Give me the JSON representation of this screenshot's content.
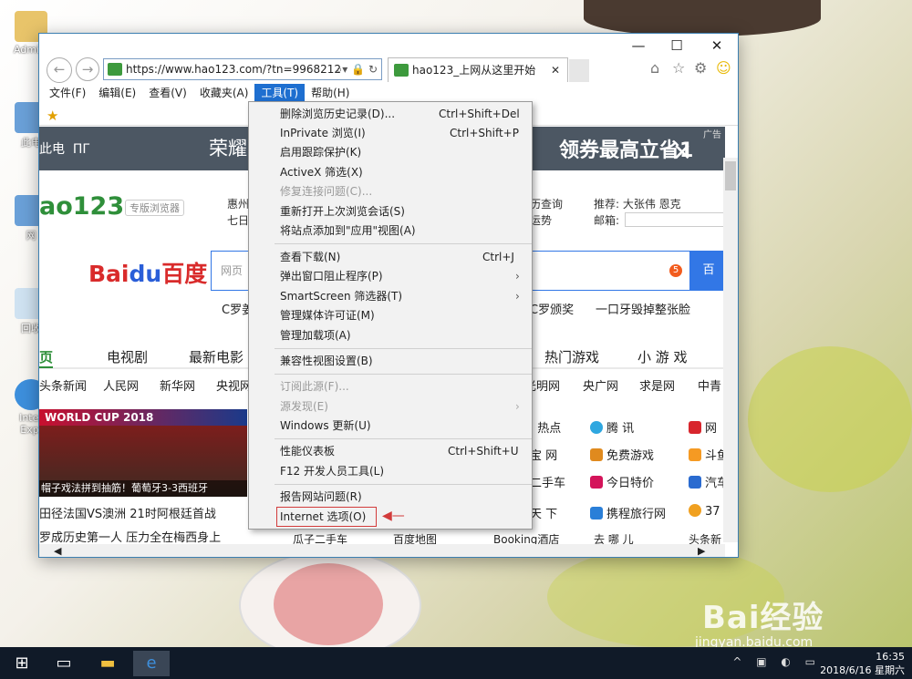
{
  "desktop": {
    "icons": [
      {
        "label": "Admini",
        "color": "#e8c46a"
      },
      {
        "label": "此电",
        "color": "#6aa0d8"
      },
      {
        "label": "网",
        "color": "#6aa0d8"
      },
      {
        "label": "回收",
        "color": "#cfe2f1"
      },
      {
        "label": "Inter\nExpl",
        "color": "#3d8fdc"
      }
    ],
    "watermark": "Bai经验",
    "watermark_url": "jingyan.baidu.com"
  },
  "browser": {
    "address": "https://www.hao123.com/?tn=9968212",
    "tab_title": "hao123_上网从这里开始",
    "menu": [
      "文件(F)",
      "编辑(E)",
      "查看(V)",
      "收藏夹(A)",
      "工具(T)",
      "帮助(H)"
    ],
    "active_menu": "工具(T)"
  },
  "page": {
    "banner_left": "荣耀",
    "banner_left_prefix": "此电  ΠΓ",
    "banner_right": "领券最高立省1",
    "ad_label": "广告",
    "hao_logo": "ao123",
    "hao_tag": "专版浏览器",
    "weather_lines": [
      "惠州",
      "七日"
    ],
    "right_info": [
      "历查询",
      "运势"
    ],
    "recommend": "推荐: 大张伟 恩克",
    "mailbox": "邮箱:",
    "baidu_logo": "Bai",
    "baidu_du": "du",
    "baidu_cn": "百度",
    "search_placeholder": "网页",
    "search_badge": "5",
    "search_button": "百",
    "hot": [
      "C罗姜",
      "C罗颁奖",
      "一口牙毁掉整张脸"
    ],
    "nav_tabs": [
      "页",
      "电视剧",
      "最新电影",
      "热门游戏",
      "小 游 戏"
    ],
    "links": [
      "头条新闻",
      "人民网",
      "新华网",
      "央视网",
      "光明网",
      "央广网",
      "求是网",
      "中青"
    ],
    "worldcup_title": "WORLD CUP 2018",
    "worldcup_caption": "帽子戏法拼到抽筋！葡萄牙3-3西班牙",
    "news": [
      "田径法国VS澳洲   21时阿根廷首战",
      "罗成历史第一人   压力全在梅西身上"
    ],
    "right_list": [
      [
        "· 热点",
        "腾  讯",
        "网"
      ],
      [
        "宝 网",
        "免费游戏",
        "斗鱼"
      ],
      [
        "二手车",
        "今日特价",
        "汽车"
      ],
      [
        "天 下",
        "携程旅行网",
        "37"
      ]
    ],
    "bottom_row": [
      "瓜子二手车",
      "百度地图",
      "Booking酒店",
      "去 哪 儿",
      "头条新"
    ]
  },
  "tools_menu": [
    {
      "label": "删除浏览历史记录(D)...",
      "shortcut": "Ctrl+Shift+Del",
      "disabled": false
    },
    {
      "label": "InPrivate 浏览(I)",
      "shortcut": "Ctrl+Shift+P",
      "disabled": false
    },
    {
      "label": "启用跟踪保护(K)",
      "shortcut": "",
      "disabled": false
    },
    {
      "label": "ActiveX 筛选(X)",
      "shortcut": "",
      "disabled": false
    },
    {
      "label": "修复连接问题(C)...",
      "shortcut": "",
      "disabled": true
    },
    {
      "label": "重新打开上次浏览会话(S)",
      "shortcut": "",
      "disabled": false
    },
    {
      "label": "将站点添加到\"应用\"视图(A)",
      "shortcut": "",
      "disabled": false
    },
    {
      "label": "查看下载(N)",
      "shortcut": "Ctrl+J",
      "disabled": false
    },
    {
      "label": "弹出窗口阻止程序(P)",
      "shortcut": "",
      "disabled": false,
      "submenu": true
    },
    {
      "label": "SmartScreen 筛选器(T)",
      "shortcut": "",
      "disabled": false,
      "submenu": true
    },
    {
      "label": "管理媒体许可证(M)",
      "shortcut": "",
      "disabled": false
    },
    {
      "label": "管理加载项(A)",
      "shortcut": "",
      "disabled": false
    },
    {
      "label": "兼容性视图设置(B)",
      "shortcut": "",
      "disabled": false
    },
    {
      "label": "订阅此源(F)...",
      "shortcut": "",
      "disabled": true
    },
    {
      "label": "源发现(E)",
      "shortcut": "",
      "disabled": true,
      "submenu": true
    },
    {
      "label": "Windows 更新(U)",
      "shortcut": "",
      "disabled": false
    },
    {
      "label": "性能仪表板",
      "shortcut": "Ctrl+Shift+U",
      "disabled": false
    },
    {
      "label": "F12 开发人员工具(L)",
      "shortcut": "",
      "disabled": false
    },
    {
      "label": "报告网站问题(R)",
      "shortcut": "",
      "disabled": false
    },
    {
      "label": "Internet 选项(O)",
      "shortcut": "",
      "disabled": false,
      "highlighted": true
    }
  ],
  "taskbar": {
    "time": "16:35",
    "date": "2018/6/16 星期六"
  }
}
